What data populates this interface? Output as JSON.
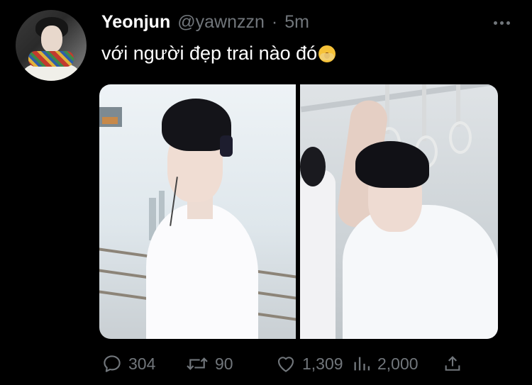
{
  "tweet": {
    "author_name": "Yeonjun",
    "author_handle": "@yawnzzn",
    "separator": "·",
    "timestamp": "5m",
    "text": "với người đẹp trai nào đó",
    "emoji": "face-with-open-eyes-and-hand-over-mouth"
  },
  "media": {
    "count": 2,
    "images": [
      {
        "alt": "photo-1"
      },
      {
        "alt": "photo-2"
      }
    ]
  },
  "actions": {
    "reply_count": "304",
    "retweet_count": "90",
    "like_count": "1,309",
    "view_count": "2,000"
  },
  "icons": {
    "reply": "speech-bubble-icon",
    "retweet": "retweet-arrows-icon",
    "like": "heart-icon",
    "views": "bar-chart-icon",
    "share": "share-upload-icon",
    "more": "more-dots-icon"
  },
  "colors": {
    "background": "#000000",
    "primary_text": "#ffffff",
    "secondary_text": "#71767b"
  }
}
